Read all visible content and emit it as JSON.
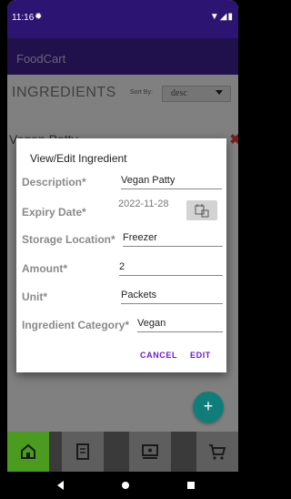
{
  "status_bar": {
    "time": "11:16"
  },
  "app_bar": {
    "title": "FoodCart"
  },
  "page": {
    "heading": "INGREDIENTS",
    "sort_label": "Sort By:",
    "sort_value": "desc",
    "list_item_partial": "Vegan Patty"
  },
  "dialog": {
    "title": "View/Edit Ingredient",
    "description_label": "Description*",
    "description_value": "Vegan Patty",
    "expiry_label": "Expiry Date*",
    "expiry_value": "2022-11-28",
    "storage_label": "Storage Location*",
    "storage_value": "Freezer",
    "amount_label": "Amount*",
    "amount_value": "2",
    "unit_label": "Unit*",
    "unit_value": "Packets",
    "category_label": "Ingredient Category*",
    "category_value": "Vegan",
    "cancel_label": "CANCEL",
    "edit_label": "EDIT"
  },
  "fab": {
    "label": "+"
  },
  "colors": {
    "status_bar": "#2c1472",
    "app_bar": "#3e1f8f",
    "accent": "#6a1bd1",
    "fab": "#0f7e7b",
    "nav_active": "#4a9b1f",
    "delete": "#e53935"
  },
  "icons": [
    "settings-icon",
    "wifi-icon",
    "signal-icon",
    "battery-icon",
    "delete-icon",
    "calendar-icon",
    "add-icon",
    "home-icon",
    "receipt-icon",
    "recipe-icon",
    "cart-icon",
    "back-icon",
    "home-circle-icon",
    "recents-icon"
  ]
}
